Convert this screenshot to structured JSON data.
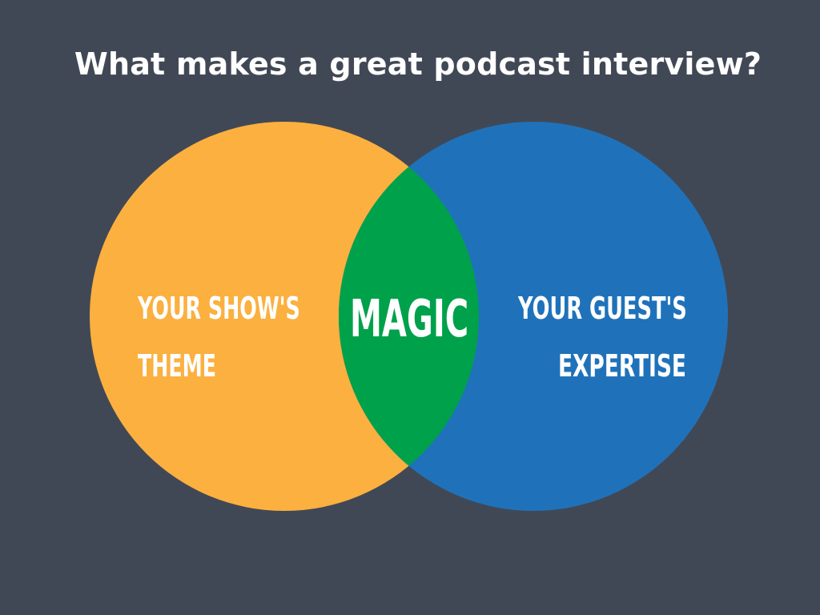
{
  "title": "What makes a great podcast interview?",
  "left_set": {
    "line1": "YOUR SHOW'S",
    "line2": "THEME",
    "color": "#FBB040"
  },
  "right_set": {
    "line1": "YOUR GUEST'S",
    "line2": "EXPERTISE",
    "color": "#1F72BA"
  },
  "intersection": {
    "label": "MAGIC",
    "color": "#00A14B"
  },
  "background_color": "#414855",
  "text_color": "#FFFFFF"
}
